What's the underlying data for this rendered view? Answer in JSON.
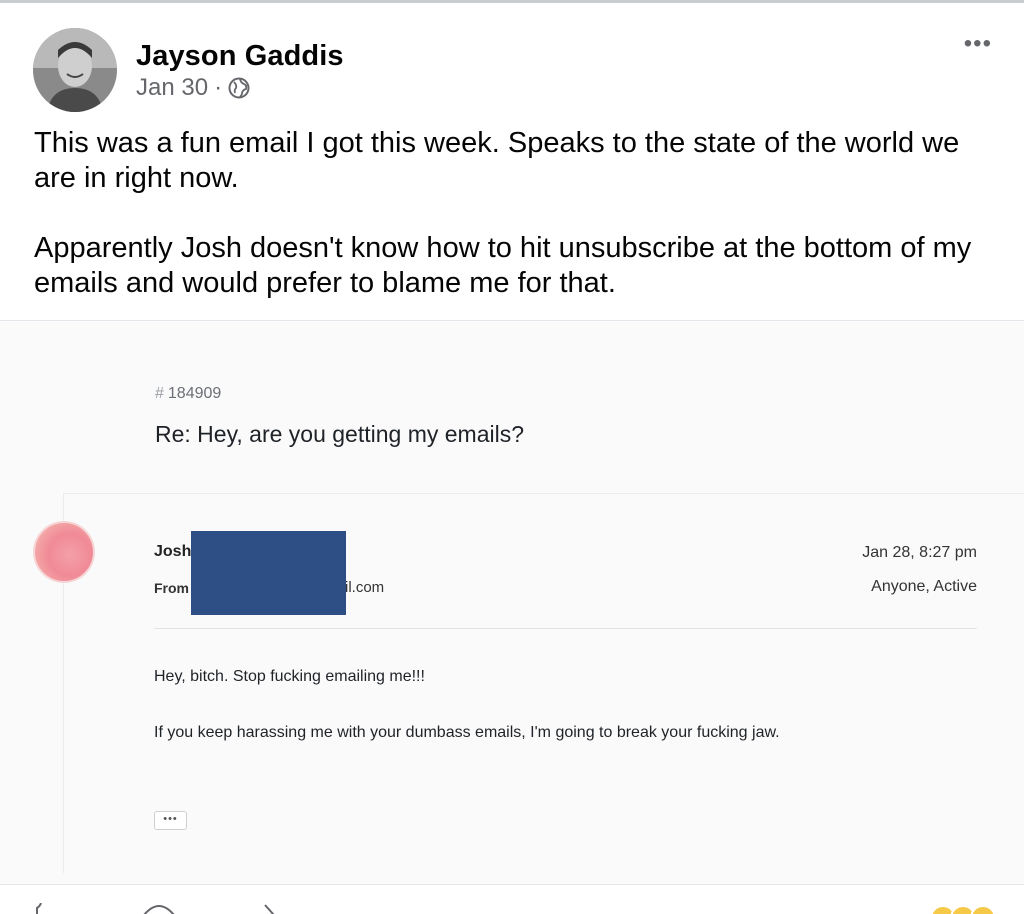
{
  "post": {
    "author": "Jayson Gaddis",
    "date": "Jan 30",
    "separator": "·",
    "more_label": "•••",
    "paragraphs": [
      "This was a fun email I got this week. Speaks to the state of the world we are in right now.",
      "Apparently Josh doesn't know how to hit unsubscribe at the bottom of my emails and would prefer to blame me for that."
    ]
  },
  "email": {
    "ticket_hash": "#",
    "ticket_number": "184909",
    "subject": "Re: Hey, are you getting my emails?",
    "sender_name": "Josh",
    "from_label": "From",
    "from_domain_fragment": "il.com",
    "date": "Jan 28, 8:27 pm",
    "status": "Anyone, Active",
    "body_line_1": "Hey, bitch. Stop fucking emailing me!!!",
    "body_line_2": "If you keep harassing me with your dumbass emails, I'm going to break your fucking jaw.",
    "expand_label": "•••",
    "redaction_color": "#2e4f86"
  },
  "icons": {
    "privacy": "globe-icon",
    "reactions": "reaction-emoji-icons"
  }
}
